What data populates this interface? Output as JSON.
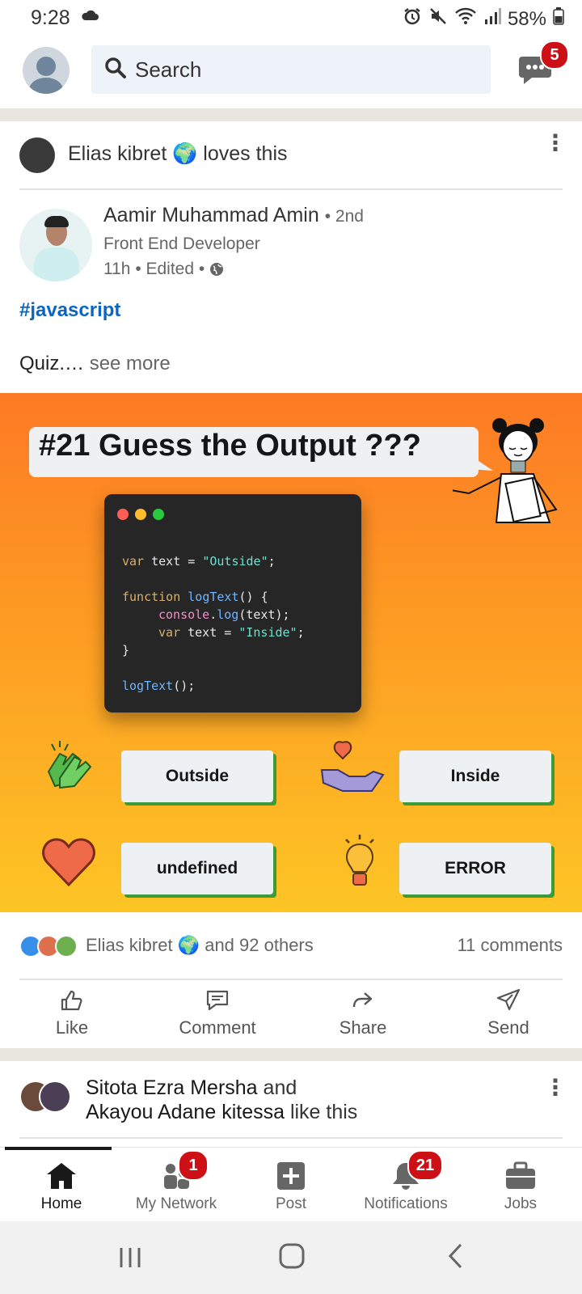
{
  "status_bar": {
    "time": "9:28",
    "battery": "58%"
  },
  "header": {
    "search_placeholder": "Search",
    "messages_badge": "5"
  },
  "post": {
    "social_context": "Elias kibret 🌍 loves this",
    "author": {
      "name": "Aamir Muhammad Amin",
      "degree": "• 2nd",
      "title": "Front End Developer",
      "meta": "11h • Edited •"
    },
    "hashtag": "#javascript",
    "body": "Quiz.…",
    "see_more": "see more",
    "image": {
      "heading": "#21 Guess the Output ???",
      "code": {
        "line1_kw": "var",
        "line1_rest": " text = ",
        "line1_str": "\"Outside\"",
        "line1_end": ";",
        "line2_kw": "function",
        "line2_fn": " logText",
        "line2_end": "() {",
        "line3_pr": "console",
        "line3_dot": ".",
        "line3_fn": "log",
        "line3_end": "(text);",
        "line4_kw": "var",
        "line4_rest": " text = ",
        "line4_str": "\"Inside\"",
        "line4_end": ";",
        "line5": "}",
        "line6_fn": "logText",
        "line6_end": "();"
      },
      "options": [
        "Outside",
        "Inside",
        "undefined",
        "ERROR"
      ]
    },
    "reactions": {
      "text": "Elias kibret 🌍 and 92 others",
      "comments": "11 comments"
    },
    "actions": [
      {
        "label": "Like",
        "icon": "like-icon"
      },
      {
        "label": "Comment",
        "icon": "comment-icon"
      },
      {
        "label": "Share",
        "icon": "share-icon"
      },
      {
        "label": "Send",
        "icon": "send-icon"
      }
    ]
  },
  "next_post": {
    "social_context_a": "Sitota Ezra Mersha",
    "and": " and ",
    "social_context_b": "Akayou Adane kitessa",
    "suffix": " like this"
  },
  "bottom_nav": [
    {
      "label": "Home",
      "icon": "home-icon",
      "active": true
    },
    {
      "label": "My Network",
      "icon": "network-icon",
      "badge": "1"
    },
    {
      "label": "Post",
      "icon": "post-icon"
    },
    {
      "label": "Notifications",
      "icon": "bell-icon",
      "badge": "21"
    },
    {
      "label": "Jobs",
      "icon": "briefcase-icon"
    }
  ]
}
